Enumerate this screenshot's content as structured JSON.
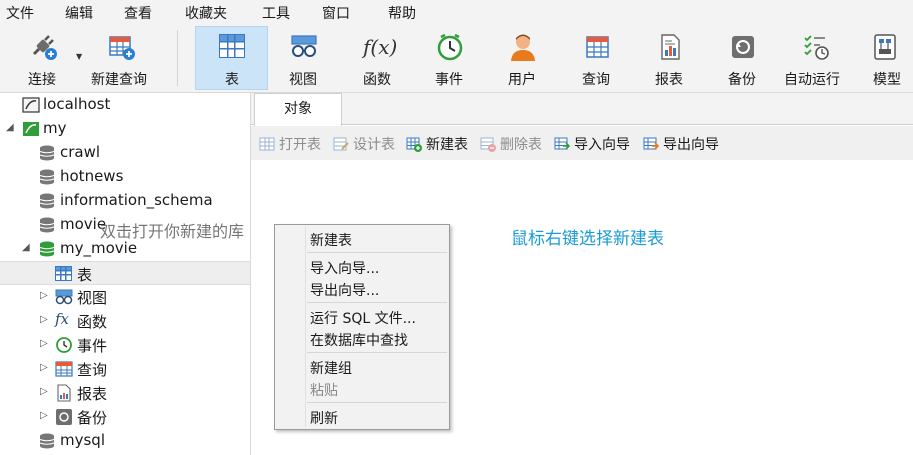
{
  "menu": [
    "文件",
    "编辑",
    "查看",
    "收藏夹",
    "工具",
    "窗口",
    "帮助"
  ],
  "toolbar": {
    "connect": "连接",
    "new_query": "新建查询",
    "table": "表",
    "view": "视图",
    "function": "函数",
    "event": "事件",
    "user": "用户",
    "query": "查询",
    "report": "报表",
    "backup": "备份",
    "automation": "自动运行",
    "model": "模型",
    "function_icon_text": "f(x)"
  },
  "tree": {
    "localhost": "localhost",
    "my": "my",
    "crawl": "crawl",
    "hotnews": "hotnews",
    "information_schema": "information_schema",
    "movie": "movie",
    "my_movie": "my_movie",
    "table": "表",
    "view": "视图",
    "function": "函数",
    "event": "事件",
    "query": "查询",
    "report": "报表",
    "backup": "备份",
    "mysql": "mysql",
    "function_icon_text": "fx"
  },
  "tabs": {
    "objects": "对象"
  },
  "object_toolbar": {
    "open_table": "打开表",
    "design_table": "设计表",
    "new_table": "新建表",
    "delete_table": "删除表",
    "import_wizard": "导入向导",
    "export_wizard": "导出向导"
  },
  "annotations": {
    "double_click": "双击打开你新建的库",
    "right_click": "鼠标右键选择新建表"
  },
  "context_menu": {
    "new_table": "新建表",
    "import_wizard": "导入向导...",
    "export_wizard": "导出向导...",
    "run_sql_file": "运行 SQL 文件...",
    "find_in_db": "在数据库中查找",
    "new_group": "新建组",
    "paste": "粘贴",
    "refresh": "刷新"
  },
  "colors": {
    "accent": "#3b78c2",
    "annotation_blue": "#1a9cd6",
    "active_tool": "#cce4f7",
    "db_green": "#2f9e3a"
  }
}
